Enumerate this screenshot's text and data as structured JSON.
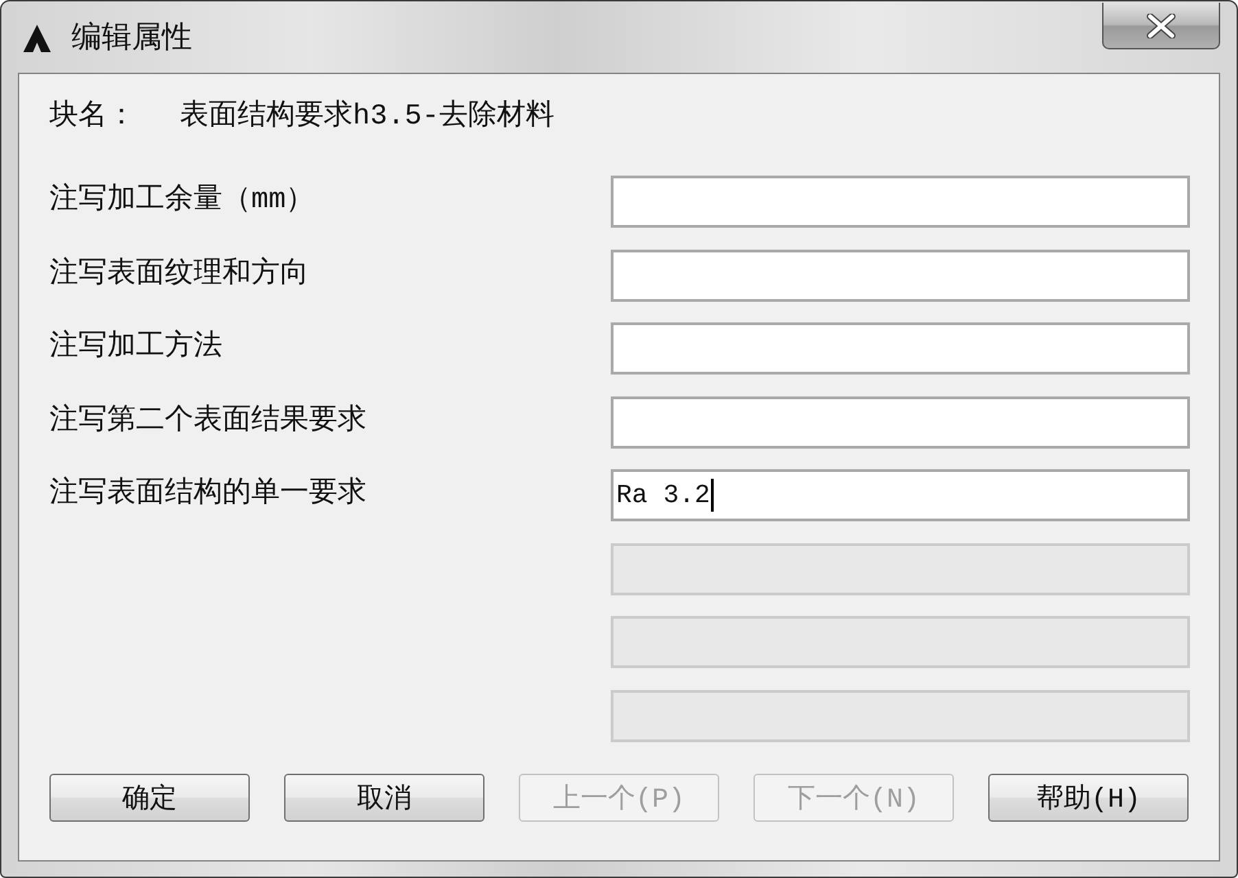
{
  "window": {
    "title": "编辑属性"
  },
  "block_name": {
    "label": "块名：",
    "value": "表面结构要求h3.5-去除材料"
  },
  "fields": [
    {
      "label": "注写加工余量（mm）",
      "disabled": false,
      "focused": false
    },
    {
      "label": "注写表面纹理和方向",
      "disabled": false,
      "focused": false
    },
    {
      "label": "注写加工方法",
      "disabled": false,
      "focused": false
    },
    {
      "label": "注写第二个表面结果要求",
      "disabled": false,
      "focused": false
    },
    {
      "label": "注写表面结构的单一要求",
      "value": "Ra 3.2",
      "disabled": false,
      "focused": true
    },
    {
      "disabled": true,
      "focused": false
    },
    {
      "disabled": true,
      "focused": false
    },
    {
      "disabled": true,
      "focused": false
    }
  ],
  "buttons": [
    {
      "label": "确定",
      "disabled": false
    },
    {
      "label": "取消",
      "disabled": false
    },
    {
      "label": "上一个(P)",
      "disabled": true
    },
    {
      "label": "下一个(N)",
      "disabled": true
    },
    {
      "label": "帮助(H)",
      "disabled": false
    }
  ]
}
